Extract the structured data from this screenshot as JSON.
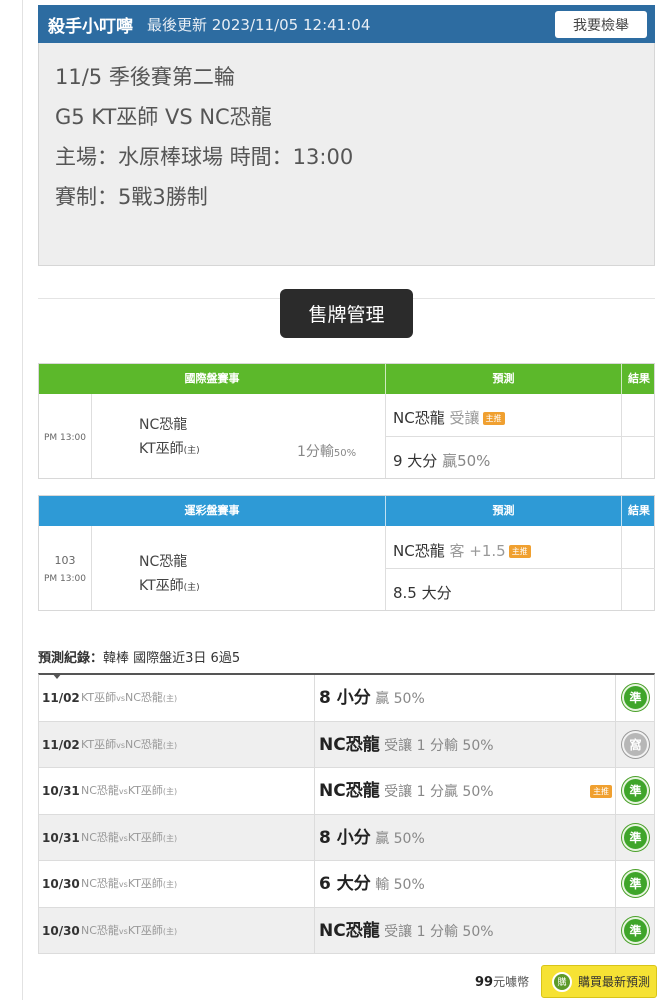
{
  "header": {
    "name": "殺手小叮嚀",
    "updated": "最後更新 2023/11/05 12:41:04",
    "report_label": "我要檢舉"
  },
  "info": {
    "line1": "11/5 季後賽第二輪",
    "line2": "G5 KT巫師 VS NC恐龍",
    "line3": "主場：水原棒球場 時間：13:00",
    "line4": "賽制：5戰3勝制"
  },
  "sell_button": "售牌管理",
  "intl_table": {
    "header_game": "國際盤賽事",
    "header_pred": "預測",
    "header_result": "結果",
    "time": "PM 13:00",
    "team_away": "NC恐龍",
    "team_home": "KT巫師",
    "home_mark": "(主)",
    "handicap": "1分輸",
    "handicap_pct": "50%",
    "pred1_team": "NC恐龍",
    "pred1_type": "受讓",
    "pred1_tag": "主推",
    "pred2_main": "9 大分",
    "pred2_val": "贏50%"
  },
  "lottery_table": {
    "header_game": "運彩盤賽事",
    "header_pred": "預測",
    "header_result": "結果",
    "number": "103",
    "time": "PM 13:00",
    "team_away": "NC恐龍",
    "team_home": "KT巫師",
    "home_mark": "(主)",
    "pred1_team": "NC恐龍",
    "pred1_type": "客 +1.5",
    "pred1_tag": "主推",
    "pred2_main": "8.5 大分"
  },
  "record": {
    "title_label": "預測紀錄：",
    "title_text": "韓棒 國際盤近3日 6過5",
    "rows": [
      {
        "date": "11/02",
        "team1": "KT巫師",
        "vs": "vs",
        "team2": "NC恐龍",
        "mark": "(主)",
        "pick": "8 小分",
        "detail": "贏 50%",
        "tag": "",
        "result": "準",
        "result_type": "win"
      },
      {
        "date": "11/02",
        "team1": "KT巫師",
        "vs": "vs",
        "team2": "NC恐龍",
        "mark": "(主)",
        "pick": "NC恐龍",
        "detail": "受讓 1 分輸 50%",
        "tag": "",
        "result": "窩",
        "result_type": "push"
      },
      {
        "date": "10/31",
        "team1": "NC恐龍",
        "vs": "vs",
        "team2": "KT巫師",
        "mark": "(主)",
        "pick": "NC恐龍",
        "detail": "受讓 1 分贏 50%",
        "tag": "主推",
        "result": "準",
        "result_type": "win"
      },
      {
        "date": "10/31",
        "team1": "NC恐龍",
        "vs": "vs",
        "team2": "KT巫師",
        "mark": "(主)",
        "pick": "8 小分",
        "detail": "贏 50%",
        "tag": "",
        "result": "準",
        "result_type": "win"
      },
      {
        "date": "10/30",
        "team1": "NC恐龍",
        "vs": "vs",
        "team2": "KT巫師",
        "mark": "(主)",
        "pick": "6 大分",
        "detail": "輸 50%",
        "tag": "",
        "result": "準",
        "result_type": "win"
      },
      {
        "date": "10/30",
        "team1": "NC恐龍",
        "vs": "vs",
        "team2": "KT巫師",
        "mark": "(主)",
        "pick": "NC恐龍",
        "detail": "受讓 1 分輸 50%",
        "tag": "",
        "result": "準",
        "result_type": "win"
      }
    ]
  },
  "footer": {
    "price_value": "99",
    "price_unit": "元噱幣",
    "buy_icon": "購",
    "buy_label": "購買最新預測"
  },
  "colors": {
    "header_blue": "#2d6ca1",
    "intl_green": "#5cb82b",
    "lottery_blue": "#2e9ad6",
    "win_green": "#3fa52a",
    "tag_orange": "#f0a030",
    "buy_yellow": "#f6e234"
  },
  "icons": {
    "caret": "caret-down-icon",
    "cart": "cart-icon"
  }
}
